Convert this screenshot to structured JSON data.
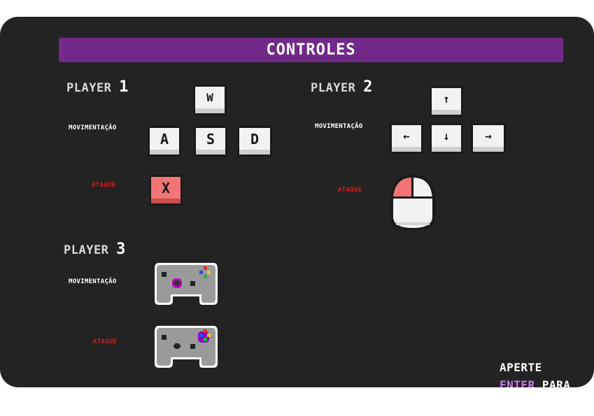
{
  "title": "CONTROLES",
  "player1": {
    "label": "PLAYER",
    "number": "1",
    "move_label": "MOVIMENTAÇÃO",
    "attack_label": "ATAQUE",
    "keys": {
      "up": "W",
      "left": "A",
      "down": "S",
      "right": "D",
      "attack": "X"
    }
  },
  "player2": {
    "label": "PLAYER",
    "number": "2",
    "move_label": "MOVIMENTAÇÃO",
    "attack_label": "ATAQUE",
    "keys": {
      "up": "↑",
      "left": "←",
      "down": "↓",
      "right": "→"
    },
    "attack_icon": "mouse-left-click-icon"
  },
  "player3": {
    "label": "PLAYER",
    "number": "3",
    "move_label": "MOVIMENTAÇÃO",
    "attack_label": "ATAQUE",
    "move_icon": "gamepad-dpad-icon",
    "attack_icon": "gamepad-button-icon"
  },
  "footer": {
    "line1": "APERTE",
    "highlight": "ENTER",
    "rest": "PARA"
  },
  "colors": {
    "panel": "#232323",
    "title_bar": "#722a8a",
    "key": "#f2f2f2",
    "attack_key": "#f27474",
    "attack_text": "#cf1f1f",
    "enter_highlight": "#c779e6"
  }
}
